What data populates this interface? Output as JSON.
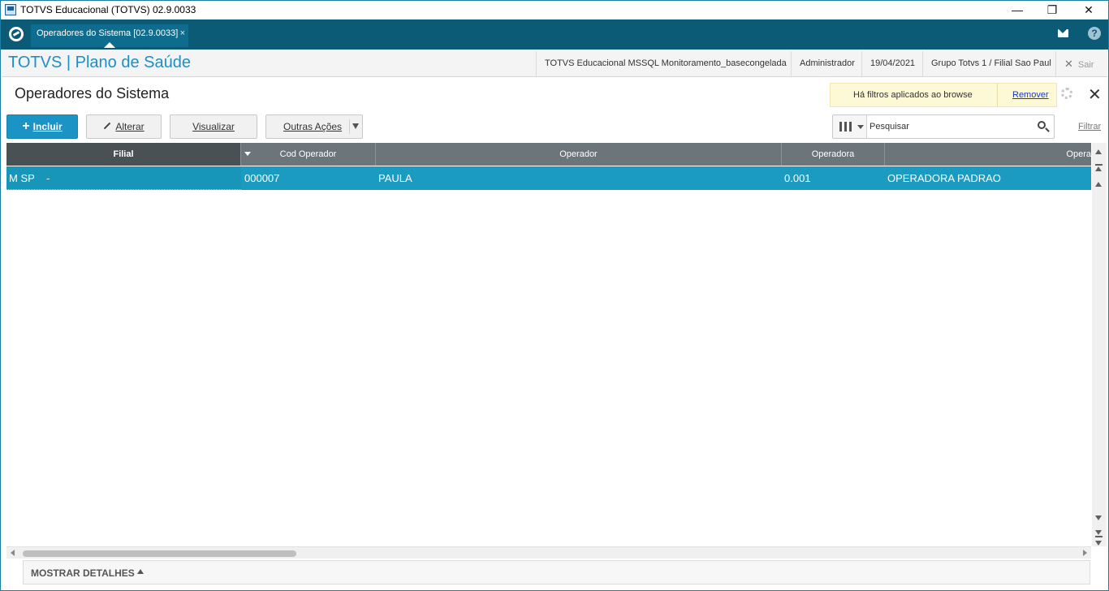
{
  "window": {
    "title": "TOTVS Educacional (TOTVS) 02.9.0033",
    "minimize": "—",
    "restore": "❐",
    "close": "✕"
  },
  "tabbar": {
    "active_tab": "Operadores do Sistema [02.9.0033]",
    "tab_close": "×",
    "help": "?"
  },
  "header": {
    "product": "TOTVS | Plano de Saúde",
    "environment": "TOTVS Educacional MSSQL Monitoramento_basecongelada",
    "user": "Administrador",
    "date": "19/04/2021",
    "branch": "Grupo Totvs 1 / Filial Sao Paul",
    "exit_label": "Sair",
    "exit_icon": "✕"
  },
  "page": {
    "title": "Operadores do Sistema",
    "filter_notice": "Há filtros aplicados ao browse",
    "remove_filter": "Remover",
    "close_icon": "✕"
  },
  "toolbar": {
    "include_icon": "+",
    "include_label": "Incluir",
    "edit_label": "Alterar",
    "view_label": "Visualizar",
    "more_actions_label": "Outras Ações"
  },
  "search": {
    "placeholder": "Pesquisar",
    "filter_link": "Filtrar"
  },
  "grid": {
    "columns": [
      "Filial",
      "Cod Operador",
      "Operador",
      "Operadora",
      "Opera"
    ],
    "rows": [
      {
        "filial": "M SP    -",
        "cod_operador": "000007",
        "operador": "PAULA",
        "operadora": "0.001",
        "nome_operadora": "OPERADORA PADRAO"
      }
    ]
  },
  "footer": {
    "details_label": "MOSTRAR DETALHES"
  },
  "colors": {
    "accent": "#1b93c4",
    "tabbar": "#0b5a76",
    "selected_row": "#1b9bc0",
    "grid_header": "#6c757a"
  }
}
